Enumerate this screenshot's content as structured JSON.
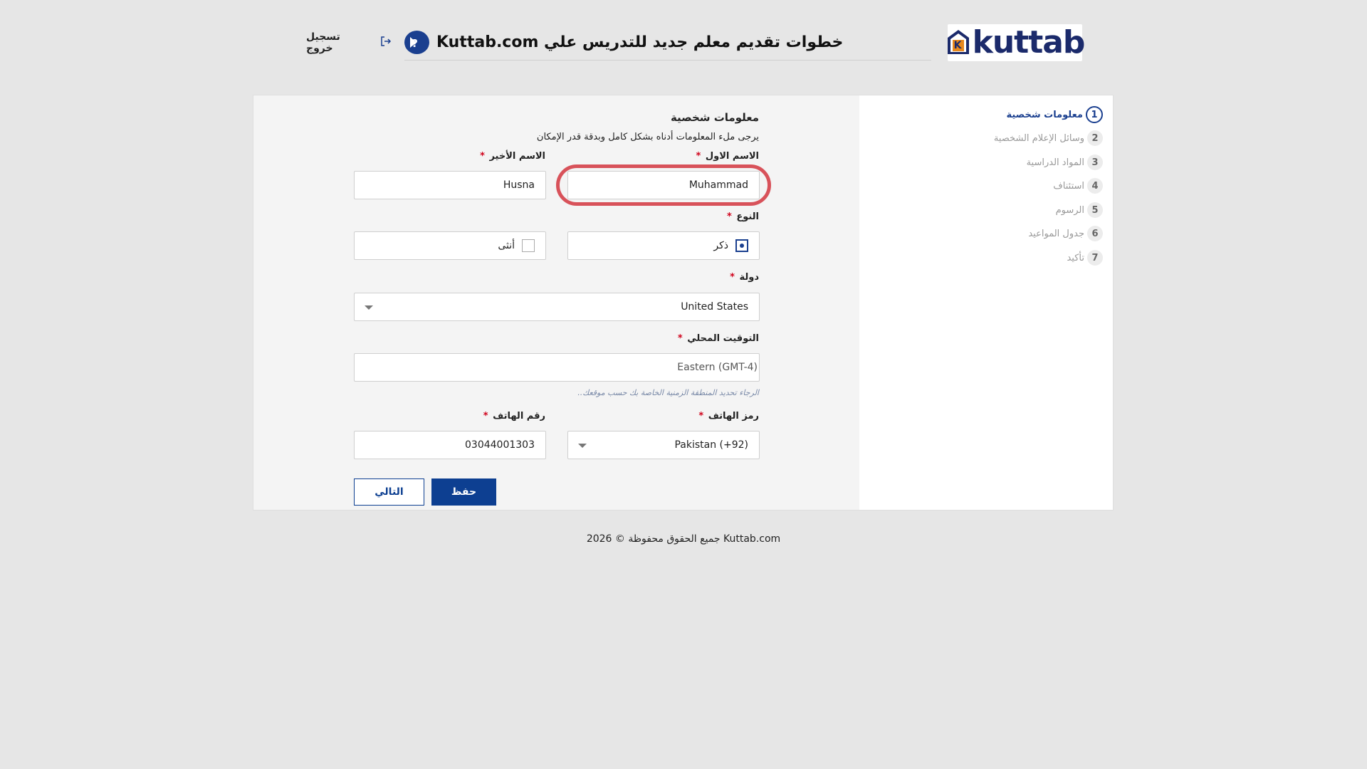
{
  "header": {
    "logo_text": "kuttab",
    "logo_badge_letter": "K",
    "title": "خطوات تقديم معلم جديد للتدريس علي Kuttab.com",
    "logout_label": "تسجيل خروج"
  },
  "steps": [
    {
      "num": "1",
      "label": "معلومات شخصية",
      "active": true
    },
    {
      "num": "2",
      "label": "وسائل الإعلام الشخصية"
    },
    {
      "num": "3",
      "label": "المواد الدراسية"
    },
    {
      "num": "4",
      "label": "استئناف"
    },
    {
      "num": "5",
      "label": "الرسوم"
    },
    {
      "num": "6",
      "label": "جدول المواعيد"
    },
    {
      "num": "7",
      "label": "تأكيد"
    }
  ],
  "form": {
    "section_title": "معلومات شخصية",
    "subtitle": "يرجى ملء المعلومات أدناه بشكل كامل وبدقة قدر الإمكان",
    "required_mark": "*",
    "first_name": {
      "label": "الاسم الاول",
      "value": "Muhammad"
    },
    "last_name": {
      "label": "الاسم الأخير",
      "value": "Husna"
    },
    "gender": {
      "label": "النوع",
      "male": "ذكر",
      "female": "أنثى",
      "selected": "male"
    },
    "country": {
      "label": "دولة",
      "value": "United States"
    },
    "timezone": {
      "label": "التوقيت المحلي",
      "value": "Eastern (GMT-4)",
      "hint": "الرجاء تحديد المنطقة الزمنية الخاصة بك حسب موقعك.."
    },
    "phone_code": {
      "label": "رمز الهاتف",
      "value": "Pakistan (+92)"
    },
    "phone_number": {
      "label": "رقم الهاتف",
      "value": "03044001303"
    },
    "save_label": "حفظ",
    "next_label": "التالي"
  },
  "footer": {
    "text": "جميع الحقوق محفوظة © 2026 Kuttab.com"
  },
  "colors": {
    "brand": "#0d3f91",
    "highlight": "#d8525a",
    "required": "#d0021b"
  }
}
